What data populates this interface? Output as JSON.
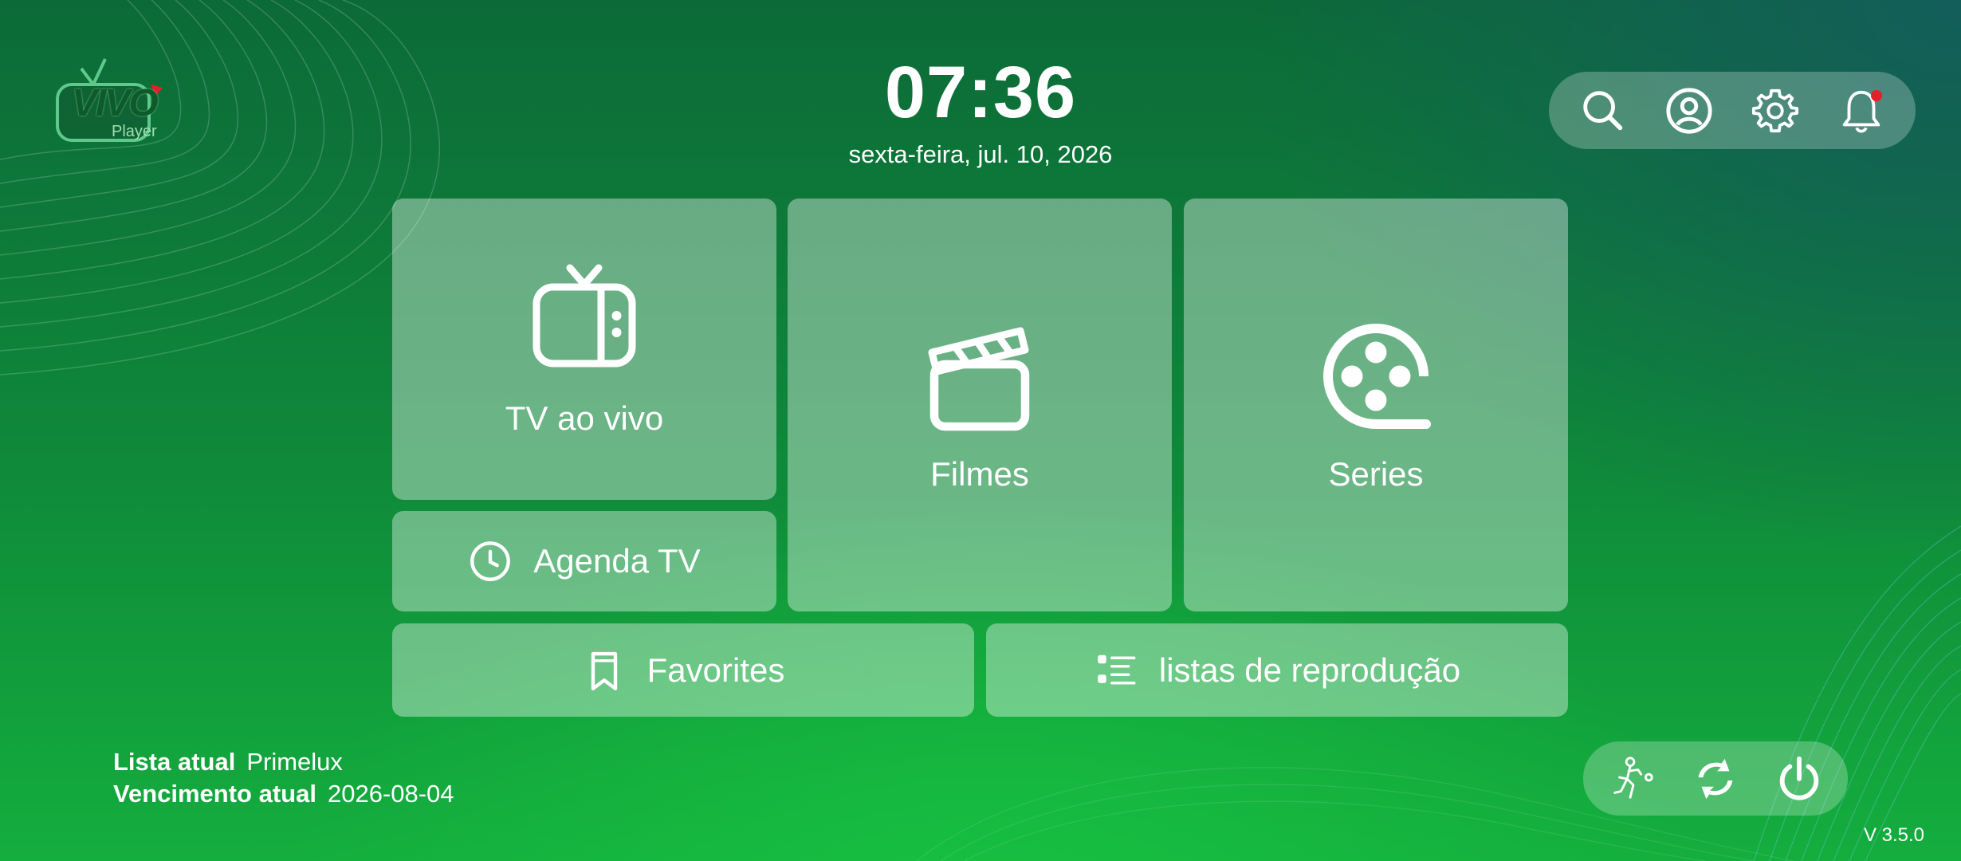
{
  "app": {
    "logo_text": "VIVO",
    "logo_sub": "Player"
  },
  "clock": {
    "time": "07:36",
    "date": "sexta-feira, jul. 10, 2026"
  },
  "topbar": {
    "icons": [
      "search-icon",
      "profile-icon",
      "gear-icon",
      "bell-icon"
    ],
    "has_notification": true
  },
  "tiles": {
    "live_tv": "TV ao vivo",
    "movies": "Filmes",
    "series": "Series",
    "tv_guide": "Agenda TV",
    "favorites": "Favorites",
    "playlists": "listas de reprodução"
  },
  "info": {
    "list_label": "Lista atual",
    "list_value": "Primelux",
    "expiry_label": "Vencimento atual",
    "expiry_value": "2026-08-04"
  },
  "bottombar": {
    "icons": [
      "sports-icon",
      "refresh-icon",
      "power-icon"
    ]
  },
  "version": "V 3.5.0",
  "colors": {
    "accent": "#0f8a3a",
    "tile": "rgba(255,255,255,0.38)",
    "notification": "#e0202a"
  }
}
